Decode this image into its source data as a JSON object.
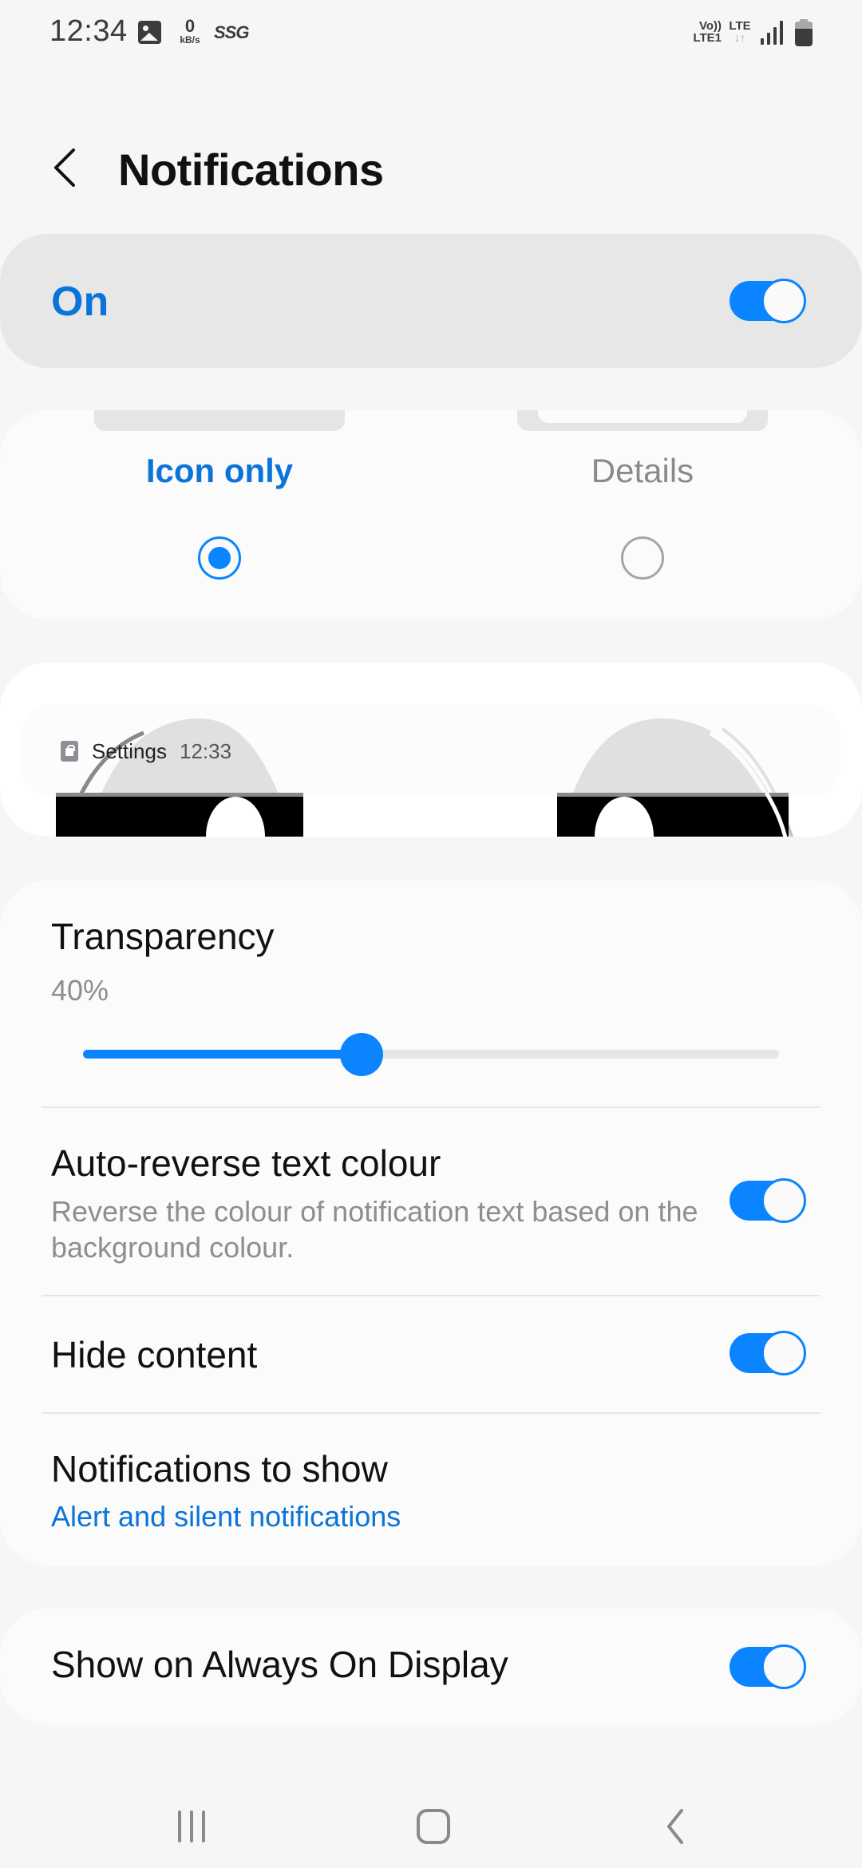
{
  "status_bar": {
    "time": "12:34",
    "gallery_icon": "gallery-icon",
    "net_speed_value": "0",
    "net_speed_unit": "kB/s",
    "carrier_badge": "SSG",
    "volte_line1": "Vo))",
    "volte_line2": "LTE1",
    "network_type": "LTE",
    "data_arrows": "↓↑",
    "signal_icon": "signal-icon",
    "battery_icon": "battery-icon"
  },
  "header": {
    "back_icon": "chevron-left-icon",
    "title": "Notifications"
  },
  "master_switch": {
    "label": "On",
    "enabled": true
  },
  "notification_style": {
    "options": [
      {
        "label": "Icon only",
        "selected": true
      },
      {
        "label": "Details",
        "selected": false
      }
    ]
  },
  "preview": {
    "notification_app": "Settings",
    "notification_time": "12:33",
    "app_icon": "lock-icon"
  },
  "settings": {
    "transparency": {
      "title": "Transparency",
      "value_label": "40%",
      "value_percent": 40
    },
    "auto_reverse": {
      "title": "Auto-reverse text colour",
      "subtitle": "Reverse the colour of notification text based on the background colour.",
      "enabled": true
    },
    "hide_content": {
      "title": "Hide content",
      "enabled": true
    },
    "notifications_to_show": {
      "title": "Notifications to show",
      "value": "Alert and silent notifications"
    }
  },
  "aod": {
    "title": "Show on Always On Display",
    "enabled": true
  },
  "navbar": {
    "recents_icon": "recents-icon",
    "home_icon": "home-icon",
    "back_icon": "back-icon"
  },
  "colors": {
    "accent": "#0a84ff",
    "accent_text": "#0a74d9",
    "background": "#f6f6f6",
    "card": "#fbfbfb",
    "master_card": "#e7e7e7",
    "secondary_text": "#8e8e8e"
  }
}
